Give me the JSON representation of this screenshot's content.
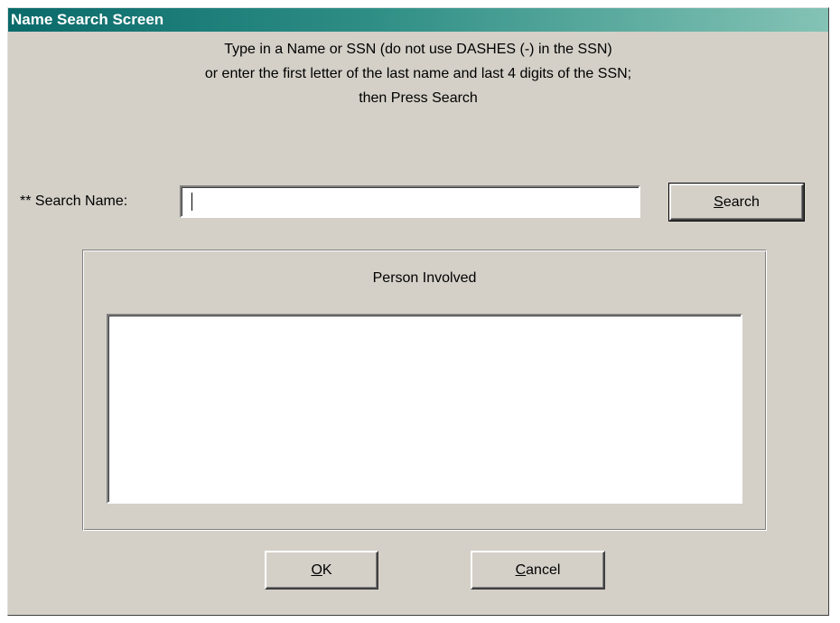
{
  "window": {
    "title": "Name Search Screen"
  },
  "instructions": {
    "line1": "Type in a Name or SSN (do not use DASHES (-) in the SSN)",
    "line2": "or enter the first letter of the last name and last 4 digits of the SSN;",
    "line3": "then Press Search"
  },
  "search": {
    "label": "** Search Name:",
    "value": "",
    "button": {
      "mnemonic": "S",
      "rest": "earch"
    }
  },
  "person_involved": {
    "title": "Person Involved",
    "items": []
  },
  "buttons": {
    "ok": {
      "mnemonic": "O",
      "rest": "K"
    },
    "cancel": {
      "mnemonic": "C",
      "rest": "ancel"
    }
  },
  "colors": {
    "dialog_bg": "#d4d0c8",
    "titlebar_start": "#0a6a6a",
    "titlebar_end": "#84c3b5"
  }
}
